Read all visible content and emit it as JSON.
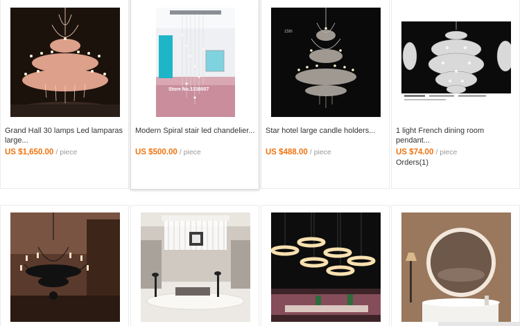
{
  "products": [
    {
      "title": "Grand Hall 30 lamps Led lamparas large...",
      "price": "US $1,650.00",
      "unit": "/ piece",
      "image_icon": "chandelier-photo"
    },
    {
      "title": "Modern Spiral stair led chandelier...",
      "price": "US $500.00",
      "unit": "/ piece",
      "image_icon": "spiral-chandelier-photo",
      "watermark": "Store No.1338007"
    },
    {
      "title": "Star hotel large candle holders...",
      "price": "US $488.00",
      "unit": "/ piece",
      "image_icon": "candle-chandelier-photo",
      "badge": "15th"
    },
    {
      "title": "1 light French dining room pendant...",
      "price": "US $74.00",
      "unit": "/ piece",
      "orders": "Orders(1)",
      "image_icon": "crystal-pendant-photo"
    },
    {
      "image_icon": "black-chandelier-photo"
    },
    {
      "image_icon": "crystal-ring-chandelier-photo"
    },
    {
      "image_icon": "ring-pendant-lights-photo"
    },
    {
      "image_icon": "led-mirror-photo"
    }
  ],
  "colors": {
    "price": "#f0730f",
    "unit": "#999999",
    "border": "#ececec"
  }
}
